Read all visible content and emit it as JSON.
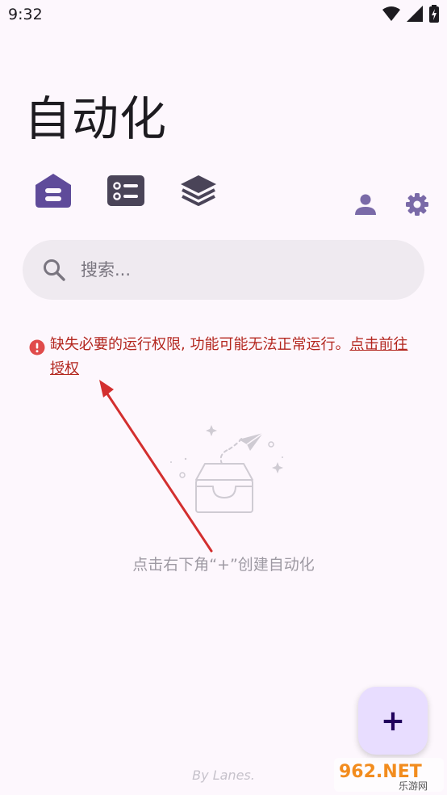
{
  "status_bar": {
    "time": "9:32",
    "icons": [
      "wifi-icon",
      "signal-icon",
      "battery-charging-icon"
    ]
  },
  "page": {
    "title": "自动化"
  },
  "tabs": [
    {
      "name": "home",
      "icon": "home-icon",
      "active": true
    },
    {
      "name": "list",
      "icon": "list-icon",
      "active": false
    },
    {
      "name": "layers",
      "icon": "layers-icon",
      "active": false
    }
  ],
  "actions": [
    {
      "icon": "user-icon"
    },
    {
      "icon": "gear-icon"
    }
  ],
  "search": {
    "placeholder": "搜索..."
  },
  "warning": {
    "message": "缺失必要的运行权限, 功能可能无法正常运行。",
    "link": "点击前往授权"
  },
  "empty_state": {
    "text": "点击右下角“+”创建自动化"
  },
  "fab": {
    "label": "+"
  },
  "footer": {
    "credit": "By Lanes."
  },
  "watermark": {
    "text": "962.NET",
    "subtext": "乐游网"
  },
  "colors": {
    "background": "#fdf7fd",
    "primary": "#5f4b9a",
    "search_bg": "#efeaf0",
    "warning": "#b3261e",
    "fab_bg": "#e8ddff",
    "annotation_arrow": "#d32f2f"
  }
}
